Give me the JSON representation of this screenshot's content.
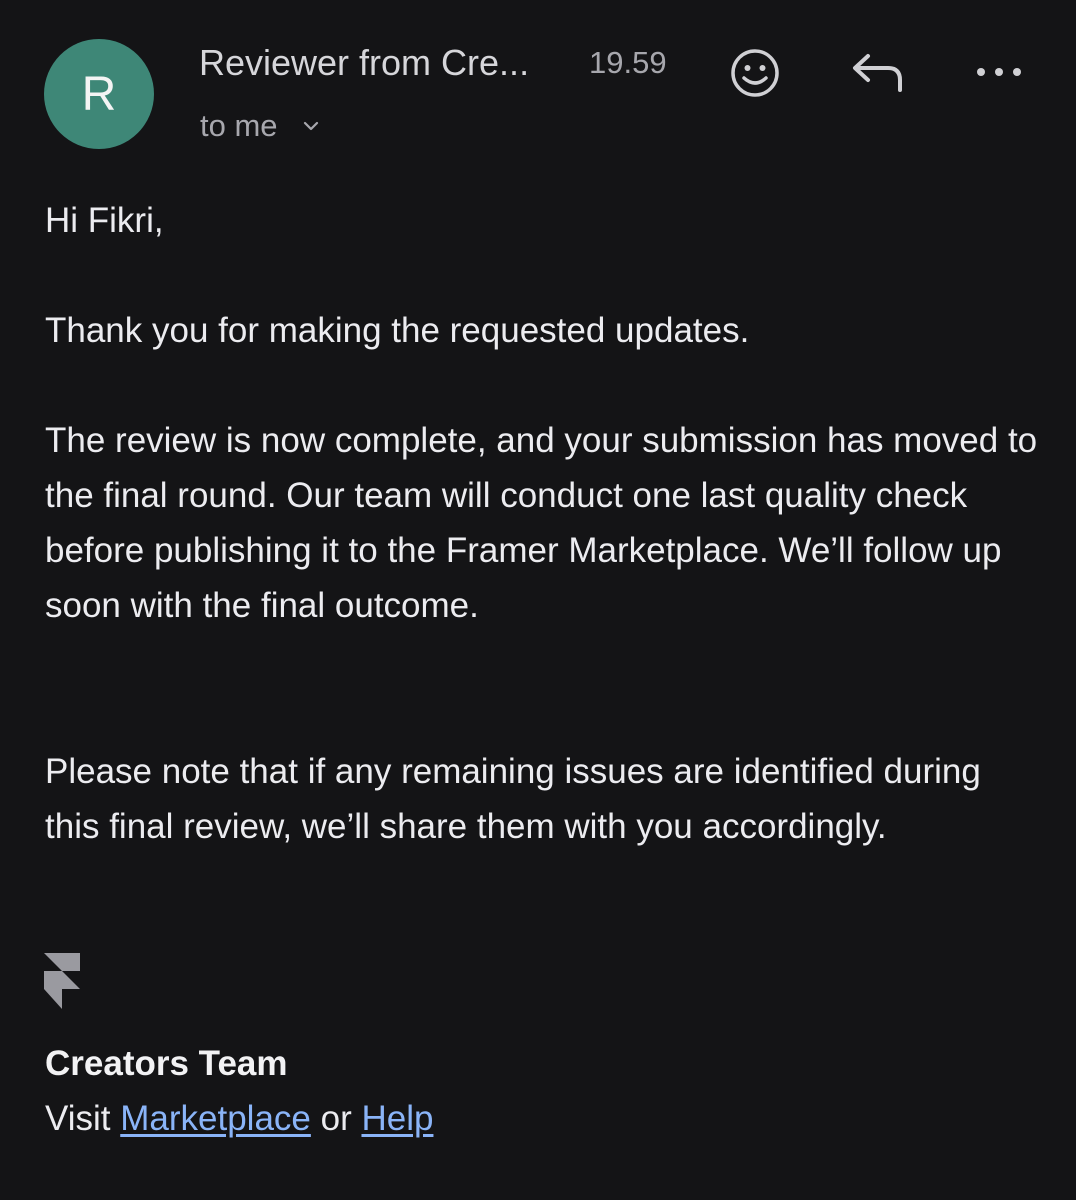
{
  "header": {
    "avatar_letter": "R",
    "avatar_color": "#3e8777",
    "sender_name": "Reviewer from Cre...",
    "time": "19.59",
    "recipient": "to me",
    "icons": {
      "emoji": "emoji-smiley-icon",
      "reply": "reply-arrow-icon",
      "more": "more-dots-icon",
      "expand": "chevron-down-icon"
    }
  },
  "body": {
    "greeting": "Hi Fikri,",
    "paragraphs": [
      "Thank you for making the requested updates.",
      "The review is now complete, and your submission has moved to the final round. Our team will conduct one last quality check before publishing it to the Framer Marketplace. We’ll follow up soon with the final outcome.",
      "Please note that if any remaining issues are identified during this final review, we’ll share them with you accordingly."
    ]
  },
  "signature": {
    "logo": "framer-logo-icon",
    "team": "Creators Team",
    "visit": "Visit",
    "link_marketplace": "Marketplace",
    "or": "or",
    "link_help": "Help",
    "link_color": "#8ab4f8"
  }
}
